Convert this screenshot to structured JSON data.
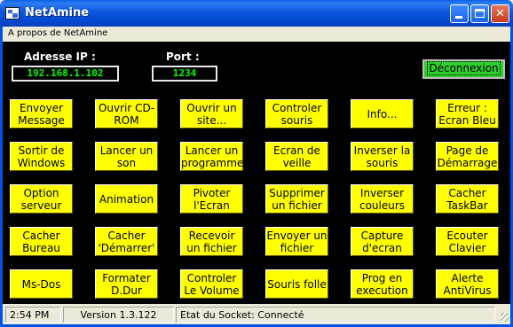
{
  "window": {
    "title": "NetAmine",
    "close_glyph": "✕"
  },
  "menu": {
    "items": [
      "A propos de NetAmine"
    ]
  },
  "connection": {
    "ip_label": "Adresse IP :",
    "ip_value": "192.168.1.102",
    "port_label": "Port :",
    "port_value": "1234",
    "disconnect_label": "Déconnexion"
  },
  "buttons": [
    [
      "Envoyer Message",
      "Ouvrir CD-ROM",
      "Ouvrir un site...",
      "Controler souris",
      "Info...",
      "Erreur : Ecran Bleu"
    ],
    [
      "Sortir de Windows",
      "Lancer un son",
      "Lancer un programme",
      "Ecran de veille",
      "Inverser la souris",
      "Page de Démarrage"
    ],
    [
      "Option serveur",
      "Animation",
      "Pivoter l'Ecran",
      "Supprimer un fichier",
      "Inverser couleurs",
      "Cacher TaskBar"
    ],
    [
      "Cacher Bureau",
      "Cacher 'Démarrer'",
      "Recevoir un fichier",
      "Envoyer un fichier",
      "Capture d'ecran",
      "Ecouter Clavier"
    ],
    [
      "Ms-Dos",
      "Formater D.Dur",
      "Controler Le Volume",
      "Souris folle",
      "Prog en execution",
      "Alerte AntiVirus"
    ]
  ],
  "status": {
    "time": "2:54 PM",
    "version": "Version 1.3.122",
    "socket": "Etat du Socket: Connecté"
  },
  "colors": {
    "button_bg": "#ffff00",
    "disconnect_bg": "#2fce2f",
    "field_text": "#00ff00",
    "client_bg": "#000000",
    "titlebar": "#0054e3"
  }
}
